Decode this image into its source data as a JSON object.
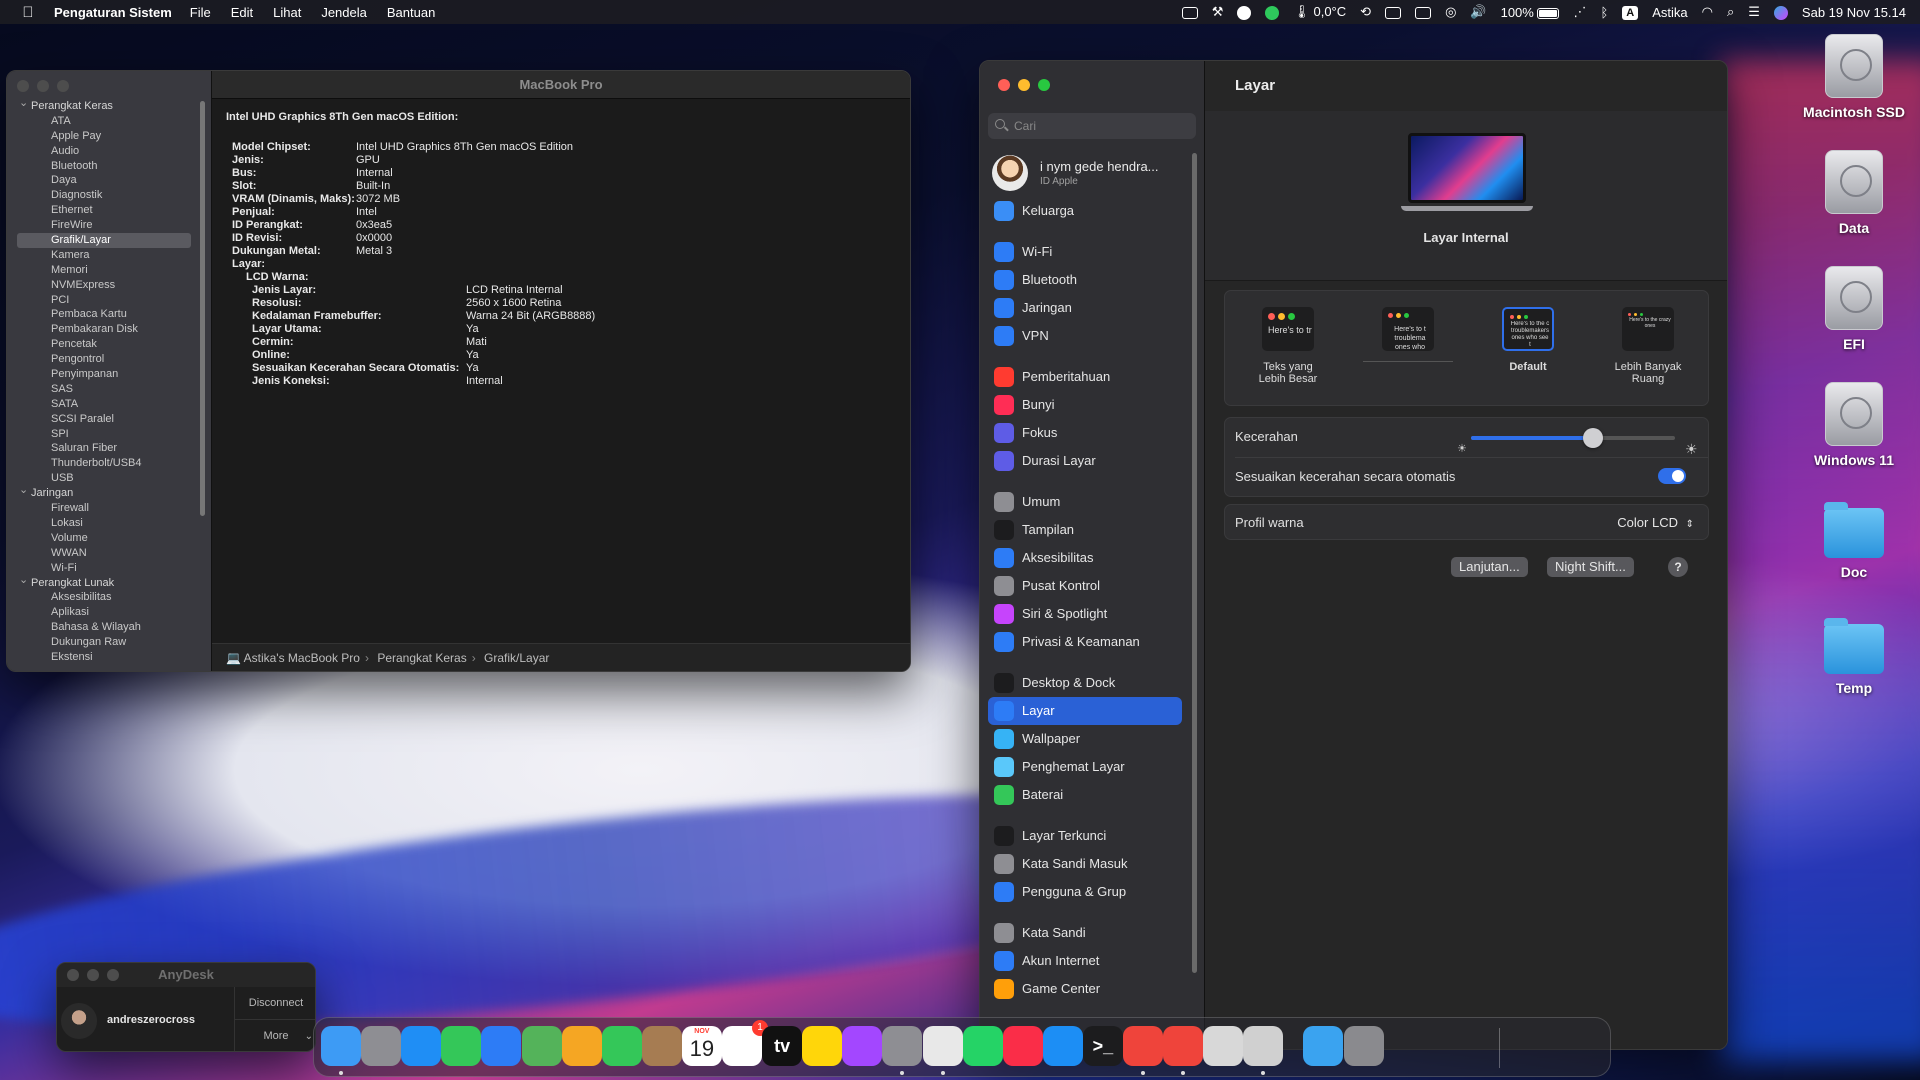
{
  "menubar": {
    "app_name": "Pengaturan Sistem",
    "menus": [
      "File",
      "Edit",
      "Lihat",
      "Jendela",
      "Bantuan"
    ],
    "temperature": "0,0°C",
    "battery_percent": "100%",
    "input_source": "A",
    "user": "Astika",
    "datetime": "Sab 19 Nov  15.14"
  },
  "desktop_icons": [
    {
      "label": "Macintosh SSD",
      "icon": "disk-icon"
    },
    {
      "label": "Data",
      "icon": "disk-icon"
    },
    {
      "label": "EFI",
      "icon": "disk-icon"
    },
    {
      "label": "Windows 11",
      "icon": "disk-icon"
    },
    {
      "label": "Doc",
      "icon": "folder-icon"
    },
    {
      "label": "Temp",
      "icon": "folder-icon"
    }
  ],
  "sysinfo": {
    "title": "MacBook Pro",
    "tree": [
      {
        "type": "group",
        "label": "Perangkat Keras"
      },
      {
        "type": "item",
        "label": "ATA"
      },
      {
        "type": "item",
        "label": "Apple Pay"
      },
      {
        "type": "item",
        "label": "Audio"
      },
      {
        "type": "item",
        "label": "Bluetooth"
      },
      {
        "type": "item",
        "label": "Daya"
      },
      {
        "type": "item",
        "label": "Diagnostik"
      },
      {
        "type": "item",
        "label": "Ethernet"
      },
      {
        "type": "item",
        "label": "FireWire"
      },
      {
        "type": "item",
        "label": "Grafik/Layar",
        "selected": true
      },
      {
        "type": "item",
        "label": "Kamera"
      },
      {
        "type": "item",
        "label": "Memori"
      },
      {
        "type": "item",
        "label": "NVMExpress"
      },
      {
        "type": "item",
        "label": "PCI"
      },
      {
        "type": "item",
        "label": "Pembaca Kartu"
      },
      {
        "type": "item",
        "label": "Pembakaran Disk"
      },
      {
        "type": "item",
        "label": "Pencetak"
      },
      {
        "type": "item",
        "label": "Pengontrol"
      },
      {
        "type": "item",
        "label": "Penyimpanan"
      },
      {
        "type": "item",
        "label": "SAS"
      },
      {
        "type": "item",
        "label": "SATA"
      },
      {
        "type": "item",
        "label": "SCSI Paralel"
      },
      {
        "type": "item",
        "label": "SPI"
      },
      {
        "type": "item",
        "label": "Saluran Fiber"
      },
      {
        "type": "item",
        "label": "Thunderbolt/USB4"
      },
      {
        "type": "item",
        "label": "USB"
      },
      {
        "type": "group",
        "label": "Jaringan"
      },
      {
        "type": "item",
        "label": "Firewall"
      },
      {
        "type": "item",
        "label": "Lokasi"
      },
      {
        "type": "item",
        "label": "Volume"
      },
      {
        "type": "item",
        "label": "WWAN"
      },
      {
        "type": "item",
        "label": "Wi-Fi"
      },
      {
        "type": "group",
        "label": "Perangkat Lunak"
      },
      {
        "type": "item",
        "label": "Aksesibilitas"
      },
      {
        "type": "item",
        "label": "Aplikasi"
      },
      {
        "type": "item",
        "label": "Bahasa & Wilayah"
      },
      {
        "type": "item",
        "label": "Dukungan Raw"
      },
      {
        "type": "item",
        "label": "Ekstensi"
      }
    ],
    "heading": "Intel UHD Graphics 8Th Gen macOS Edition:",
    "props": [
      {
        "k": "Model Chipset:",
        "v": "Intel UHD Graphics 8Th Gen macOS Edition"
      },
      {
        "k": "Jenis:",
        "v": "GPU"
      },
      {
        "k": "Bus:",
        "v": "Internal"
      },
      {
        "k": "Slot:",
        "v": "Built-In"
      },
      {
        "k": "VRAM (Dinamis, Maks):",
        "v": "3072 MB"
      },
      {
        "k": "Penjual:",
        "v": "Intel"
      },
      {
        "k": "ID Perangkat:",
        "v": "0x3ea5"
      },
      {
        "k": "ID Revisi:",
        "v": "0x0000"
      },
      {
        "k": "Dukungan Metal:",
        "v": "Metal 3"
      }
    ],
    "layar_label": "Layar:",
    "display_name": "LCD Warna:",
    "display_props": [
      {
        "k": "Jenis Layar:",
        "v": "LCD Retina Internal"
      },
      {
        "k": "Resolusi:",
        "v": "2560 x 1600 Retina"
      },
      {
        "k": "Kedalaman Framebuffer:",
        "v": "Warna 24 Bit (ARGB8888)"
      },
      {
        "k": "Layar Utama:",
        "v": "Ya"
      },
      {
        "k": "Cermin:",
        "v": "Mati"
      },
      {
        "k": "Online:",
        "v": "Ya"
      },
      {
        "k": "Sesuaikan Kecerahan Secara Otomatis:",
        "v": "Ya"
      },
      {
        "k": "Jenis Koneksi:",
        "v": "Internal"
      }
    ],
    "path": [
      "Astika's MacBook Pro",
      "Perangkat Keras",
      "Grafik/Layar"
    ]
  },
  "prefs": {
    "search_placeholder": "Cari",
    "account_name": "i nym gede hendra...",
    "account_sub": "ID Apple",
    "nav": [
      {
        "label": "Keluarga",
        "color": "#3a8ef6"
      },
      {
        "gap": true
      },
      {
        "label": "Wi-Fi",
        "color": "#2d7cf6"
      },
      {
        "label": "Bluetooth",
        "color": "#2d7cf6"
      },
      {
        "label": "Jaringan",
        "color": "#2d7cf6"
      },
      {
        "label": "VPN",
        "color": "#2d7cf6"
      },
      {
        "gap": true
      },
      {
        "label": "Pemberitahuan",
        "color": "#ff3b30"
      },
      {
        "label": "Bunyi",
        "color": "#ff2d55"
      },
      {
        "label": "Fokus",
        "color": "#5e5ce6"
      },
      {
        "label": "Durasi Layar",
        "color": "#5e5ce6"
      },
      {
        "gap": true
      },
      {
        "label": "Umum",
        "color": "#8e8e93"
      },
      {
        "label": "Tampilan",
        "color": "#1c1c1e"
      },
      {
        "label": "Aksesibilitas",
        "color": "#2d7cf6"
      },
      {
        "label": "Pusat Kontrol",
        "color": "#8e8e93"
      },
      {
        "label": "Siri & Spotlight",
        "color": "#c644fc"
      },
      {
        "label": "Privasi & Keamanan",
        "color": "#2d7cf6"
      },
      {
        "gap": true
      },
      {
        "label": "Desktop & Dock",
        "color": "#1c1c1e"
      },
      {
        "label": "Layar",
        "color": "#2d7cf6",
        "selected": true
      },
      {
        "label": "Wallpaper",
        "color": "#36b3f5"
      },
      {
        "label": "Penghemat Layar",
        "color": "#5ac8fa"
      },
      {
        "label": "Baterai",
        "color": "#34c759"
      },
      {
        "gap": true
      },
      {
        "label": "Layar Terkunci",
        "color": "#1c1c1e"
      },
      {
        "label": "Kata Sandi Masuk",
        "color": "#8e8e93"
      },
      {
        "label": "Pengguna & Grup",
        "color": "#2d7cf6"
      },
      {
        "gap": true
      },
      {
        "label": "Kata Sandi",
        "color": "#8e8e93"
      },
      {
        "label": "Akun Internet",
        "color": "#2d7cf6"
      },
      {
        "label": "Game Center",
        "color": "#ff9f0a"
      }
    ],
    "page_title": "Layar",
    "display_caption": "Layar Internal",
    "resolution_options": [
      {
        "label": "Teks yang\nLebih Besar",
        "sample": "Here's to troublem",
        "selected": false
      },
      {
        "label": "",
        "sample": "Here's to t troublema ones who",
        "selected": false
      },
      {
        "label": "Default",
        "sample": "Here's to the c troublemakers ones who see t",
        "selected": true
      },
      {
        "label": "Lebih Banyak\nRuang",
        "sample": "Here's to the crazy ones",
        "selected": false
      }
    ],
    "brightness_label": "Kecerahan",
    "brightness_level": 0.6,
    "auto_brightness_label": "Sesuaikan kecerahan secara otomatis",
    "auto_brightness_on": true,
    "color_profile_label": "Profil warna",
    "color_profile_value": "Color LCD",
    "advanced_button": "Lanjutan...",
    "nightshift_button": "Night Shift...",
    "help_button": "?"
  },
  "anydesk": {
    "title": "AnyDesk",
    "user": "andreszerocross",
    "disconnect": "Disconnect",
    "more": "More"
  },
  "dock": {
    "apps": [
      {
        "name": "finder-icon",
        "color": "#3d9bf5",
        "running": true
      },
      {
        "name": "launchpad-icon",
        "color": "#8e8e93"
      },
      {
        "name": "safari-icon",
        "color": "#1f8ef5"
      },
      {
        "name": "messages-icon",
        "color": "#34c759"
      },
      {
        "name": "mail-icon",
        "color": "#2d7cf6"
      },
      {
        "name": "maps-icon",
        "color": "#54b35a"
      },
      {
        "name": "photos-icon",
        "color": "#f5a623"
      },
      {
        "name": "facetime-icon",
        "color": "#34c759"
      },
      {
        "name": "contacts-icon",
        "color": "#a67c52"
      },
      {
        "name": "calendar-icon",
        "color": "#ffffff",
        "calendar_month": "NOV",
        "calendar_day": "19"
      },
      {
        "name": "reminders-icon",
        "color": "#ffffff",
        "badge": "1"
      },
      {
        "name": "apple-tv-icon",
        "color": "#111111",
        "glyph": "tv"
      },
      {
        "name": "notes-icon",
        "color": "#ffd60a"
      },
      {
        "name": "podcasts-icon",
        "color": "#a347ff"
      },
      {
        "name": "system-settings-icon",
        "color": "#8e8e93",
        "running": true
      },
      {
        "name": "chrome-icon",
        "color": "#e8e8e8",
        "running": true
      },
      {
        "name": "whatsapp-icon",
        "color": "#25d366"
      },
      {
        "name": "music-icon",
        "color": "#fa2d48"
      },
      {
        "name": "app-store-icon",
        "color": "#1c8ef5"
      },
      {
        "name": "terminal-icon",
        "color": "#1c1c1e",
        "glyph": ">_"
      },
      {
        "name": "anydesk-icon",
        "color": "#ef443b",
        "running": true
      },
      {
        "name": "anydesk-alt-icon",
        "color": "#ef443b",
        "running": true
      },
      {
        "name": "preview-icon",
        "color": "#d8d8d8"
      },
      {
        "name": "system-info-icon",
        "color": "#d0d0d0",
        "running": true
      },
      {
        "name": "downloads-folder-icon",
        "color": "#3aa3f0"
      },
      {
        "name": "trash-icon",
        "color": "#8a8a8e"
      }
    ]
  }
}
